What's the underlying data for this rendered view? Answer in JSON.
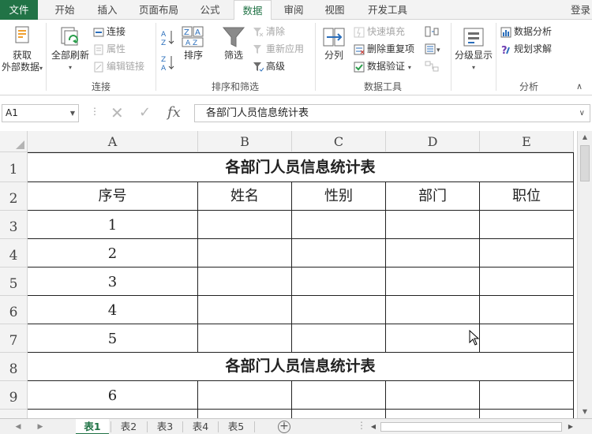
{
  "ribbon_tabs": [
    {
      "label": "文件"
    },
    {
      "label": "开始"
    },
    {
      "label": "插入"
    },
    {
      "label": "页面布局"
    },
    {
      "label": "公式"
    },
    {
      "label": "数据"
    },
    {
      "label": "审阅"
    },
    {
      "label": "视图"
    },
    {
      "label": "开发工具"
    }
  ],
  "login_label": "登录",
  "ribbon": {
    "get_external_line1": "获取",
    "get_external_line2": "外部数据",
    "refresh_all": "全部刷新",
    "connections": "连接",
    "properties": "属性",
    "edit_links": "编辑链接",
    "group_connections": "连接",
    "sort": "排序",
    "filter": "筛选",
    "clear": "清除",
    "reapply": "重新应用",
    "advanced": "高级",
    "group_sort_filter": "排序和筛选",
    "text_to_columns": "分列",
    "flash_fill": "快速填充",
    "remove_duplicates": "删除重复项",
    "data_validation": "数据验证",
    "group_data_tools": "数据工具",
    "outline": "分级显示",
    "data_analysis": "数据分析",
    "solver": "规划求解",
    "group_analysis": "分析"
  },
  "formula_bar": {
    "name_box": "A1",
    "formula": "各部门人员信息统计表"
  },
  "columns": [
    "A",
    "B",
    "C",
    "D",
    "E"
  ],
  "rows": [
    "1",
    "2",
    "3",
    "4",
    "5",
    "6",
    "7",
    "8",
    "9"
  ],
  "sheet": {
    "title_1": "各部门人员信息统计表",
    "headers": [
      "序号",
      "姓名",
      "性别",
      "部门",
      "职位"
    ],
    "serials": [
      "1",
      "2",
      "3",
      "4",
      "5"
    ],
    "title_2": "各部门人员信息统计表",
    "serial_row9": "6"
  },
  "sheet_tabs": [
    "表1",
    "表2",
    "表3",
    "表4",
    "表5"
  ],
  "colors": {
    "excel_green": "#217346",
    "header_bg": "#f3f3f3",
    "gridline": "#222222"
  }
}
